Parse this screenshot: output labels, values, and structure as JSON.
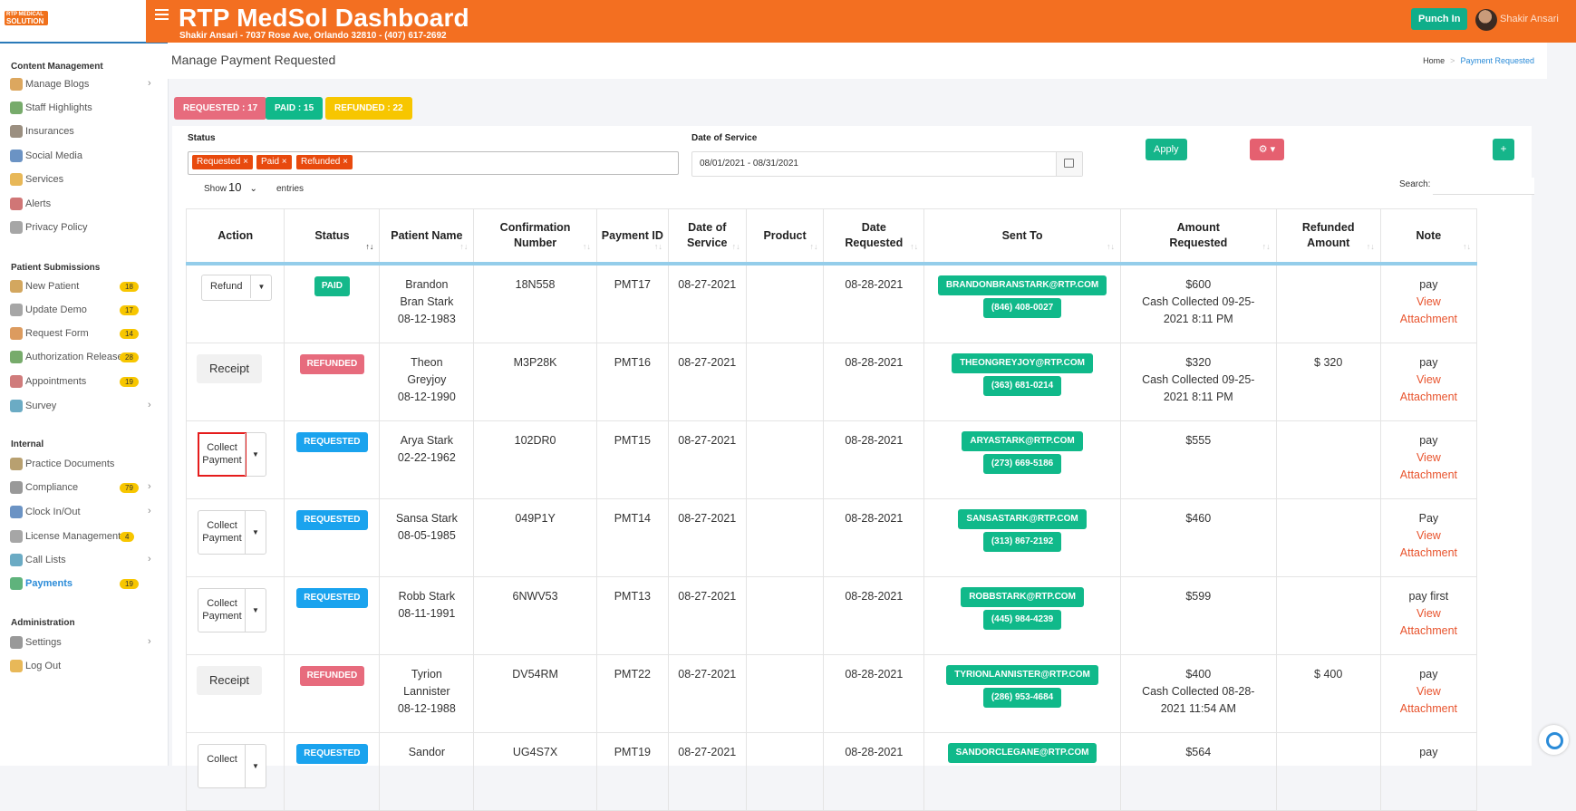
{
  "app": {
    "logo_line1": "RTP MEDICAL",
    "logo_line2": "SOLUTION",
    "title": "RTP MedSol Dashboard",
    "subtitle": "Shakir Ansari - 7037 Rose Ave, Orlando 32810 - (407) 617-2692",
    "punch_label": "Punch In",
    "user_name": "Shakir Ansari"
  },
  "sidebar": {
    "sections": [
      {
        "title": "Content Management"
      },
      {
        "title": "Patient Submissions"
      },
      {
        "title": "Internal"
      },
      {
        "title": "Administration"
      }
    ],
    "items": [
      {
        "label": "Manage Blogs",
        "chev": "›",
        "icon": "blog-icon",
        "color": "#d08a2a"
      },
      {
        "label": "Staff Highlights",
        "icon": "staff-icon",
        "color": "#4a8f3a"
      },
      {
        "label": "Insurances",
        "icon": "insurance-icon",
        "color": "#7a6a55"
      },
      {
        "label": "Social Media",
        "icon": "social-icon",
        "color": "#3a6fb0"
      },
      {
        "label": "Services",
        "icon": "services-icon",
        "color": "#e0a020"
      },
      {
        "label": "Alerts",
        "icon": "alert-icon",
        "color": "#c04848"
      },
      {
        "label": "Privacy Policy",
        "icon": "privacy-icon",
        "color": "#888"
      },
      {
        "label": "New Patient",
        "badge": "18",
        "icon": "new-patient-icon",
        "color": "#c48a2a"
      },
      {
        "label": "Update Demo",
        "badge": "17",
        "icon": "update-demo-icon",
        "color": "#888"
      },
      {
        "label": "Request Form",
        "badge": "14",
        "icon": "request-form-icon",
        "color": "#d07a2a"
      },
      {
        "label": "Authorization Release",
        "badge": "28",
        "icon": "auth-icon",
        "color": "#4a8f3a"
      },
      {
        "label": "Appointments",
        "badge": "19",
        "icon": "calendar-icon",
        "color": "#c05050"
      },
      {
        "label": "Survey",
        "chev": "›",
        "icon": "survey-icon",
        "color": "#3a8fb0"
      },
      {
        "label": "Practice Documents",
        "icon": "documents-icon",
        "color": "#a08040"
      },
      {
        "label": "Compliance",
        "badge": "79",
        "chev": "›",
        "icon": "compliance-icon",
        "color": "#777"
      },
      {
        "label": "Clock In/Out",
        "chev": "›",
        "icon": "clock-icon",
        "color": "#3a6fb0"
      },
      {
        "label": "License Management",
        "badge": "4",
        "icon": "license-icon",
        "color": "#888"
      },
      {
        "label": "Call Lists",
        "chev": "›",
        "icon": "call-list-icon",
        "color": "#3a8fb0"
      },
      {
        "label": "Payments",
        "badge": "19",
        "icon": "payments-icon",
        "color": "#2a9a50"
      },
      {
        "label": "Settings",
        "chev": "›",
        "icon": "settings-icon",
        "color": "#777"
      },
      {
        "label": "Log Out",
        "icon": "logout-icon",
        "color": "#e0a020"
      }
    ]
  },
  "breadcrumb": {
    "page_title": "Manage Payment Requested",
    "home": "Home",
    "sep": ">",
    "current": "Payment Requested"
  },
  "counts": {
    "requested": "REQUESTED : 17",
    "paid": "PAID : 15",
    "refunded": "REFUNDED : 22"
  },
  "colors": {
    "requested": "#e76b7d",
    "paid": "#10b98a",
    "refunded": "#f7c600",
    "status_paid": "#14b88a",
    "status_refunded": "#e76b7d",
    "status_requested": "#1aa3ee"
  },
  "filters": {
    "status_label": "Status",
    "status_chips": [
      "Requested ×",
      "Paid ×",
      "Refunded ×"
    ],
    "date_label": "Date of Service",
    "date_value": "08/01/2021 - 08/31/2021",
    "apply_label": "Apply",
    "gear_label": "⚙ ▾",
    "plus_label": "+"
  },
  "table_controls": {
    "show": "Show",
    "entries_value": "10",
    "entries": "entries",
    "search": "Search:"
  },
  "table": {
    "headers": [
      "Action",
      "Status",
      "Patient Name",
      "Confirmation Number",
      "Payment ID",
      "Date of Service",
      "Product",
      "Date Requested",
      "Sent To",
      "Amount Requested",
      "Refunded Amount",
      "Note"
    ],
    "rows": [
      {
        "action": "Refund",
        "action_type": "split",
        "status": "PAID",
        "status_color": "#14b88a",
        "patient": [
          "Brandon",
          "Bran Stark",
          "08-12-1983"
        ],
        "confirmation": "18N558",
        "payment_id": "PMT17",
        "dos": "08-27-2021",
        "product": "",
        "requested": "08-28-2021",
        "email": "BRANDONBRANSTARK@RTP.COM",
        "phone": "(846) 408-0027",
        "amount": [
          "$600",
          "Cash Collected 09-25-",
          "2021 8:11 PM"
        ],
        "refunded": "",
        "note": "pay",
        "note_link": [
          "View",
          "Attachment"
        ]
      },
      {
        "action": "Receipt",
        "action_type": "receipt",
        "status": "REFUNDED",
        "status_color": "#e76b7d",
        "patient": [
          "Theon",
          "Greyjoy",
          "08-12-1990"
        ],
        "confirmation": "M3P28K",
        "payment_id": "PMT16",
        "dos": "08-27-2021",
        "product": "",
        "requested": "08-28-2021",
        "email": "THEONGREYJOY@RTP.COM",
        "phone": "(363) 681-0214",
        "amount": [
          "$320",
          "Cash Collected 09-25-",
          "2021 8:11 PM"
        ],
        "refunded": "$ 320",
        "note": "pay",
        "note_link": [
          "View",
          "Attachment"
        ]
      },
      {
        "action": "Collect Payment",
        "action_type": "collect",
        "highlight": true,
        "status": "REQUESTED",
        "status_color": "#1aa3ee",
        "patient": [
          "Arya Stark",
          "02-22-1962"
        ],
        "confirmation": "102DR0",
        "payment_id": "PMT15",
        "dos": "08-27-2021",
        "product": "",
        "requested": "08-28-2021",
        "email": "ARYASTARK@RTP.COM",
        "phone": "(273) 669-5186",
        "amount": [
          "$555"
        ],
        "refunded": "",
        "note": "pay",
        "note_link": [
          "View",
          "Attachment"
        ]
      },
      {
        "action": "Collect Payment",
        "action_type": "collect",
        "status": "REQUESTED",
        "status_color": "#1aa3ee",
        "patient": [
          "Sansa Stark",
          "08-05-1985"
        ],
        "confirmation": "049P1Y",
        "payment_id": "PMT14",
        "dos": "08-27-2021",
        "product": "",
        "requested": "08-28-2021",
        "email": "SANSASTARK@RTP.COM",
        "phone": "(313) 867-2192",
        "amount": [
          "$460"
        ],
        "refunded": "",
        "note": "Pay",
        "note_link": [
          "View",
          "Attachment"
        ]
      },
      {
        "action": "Collect Payment",
        "action_type": "collect",
        "status": "REQUESTED",
        "status_color": "#1aa3ee",
        "patient": [
          "Robb Stark",
          "08-11-1991"
        ],
        "confirmation": "6NWV53",
        "payment_id": "PMT13",
        "dos": "08-27-2021",
        "product": "",
        "requested": "08-28-2021",
        "email": "ROBBSTARK@RTP.COM",
        "phone": "(445) 984-4239",
        "amount": [
          "$599"
        ],
        "refunded": "",
        "note": "pay first",
        "note_link": [
          "View",
          "Attachment"
        ]
      },
      {
        "action": "Receipt",
        "action_type": "receipt",
        "status": "REFUNDED",
        "status_color": "#e76b7d",
        "patient": [
          "Tyrion",
          "Lannister",
          "08-12-1988"
        ],
        "confirmation": "DV54RM",
        "payment_id": "PMT22",
        "dos": "08-27-2021",
        "product": "",
        "requested": "08-28-2021",
        "email": "TYRIONLANNISTER@RTP.COM",
        "phone": "(286) 953-4684",
        "amount": [
          "$400",
          "Cash Collected 08-28-",
          "2021 11:54 AM"
        ],
        "refunded": "$ 400",
        "note": "pay",
        "note_link": [
          "View",
          "Attachment"
        ]
      },
      {
        "action": "Collect",
        "action_type": "collect",
        "status": "REQUESTED",
        "status_color": "#1aa3ee",
        "patient": [
          "Sandor"
        ],
        "confirmation": "UG4S7X",
        "payment_id": "PMT19",
        "dos": "08-27-2021",
        "product": "",
        "requested": "08-28-2021",
        "email": "SANDORCLEGANE@RTP.COM",
        "phone": "",
        "amount": [
          "$564"
        ],
        "refunded": "",
        "note": "pay",
        "note_link": []
      }
    ]
  }
}
